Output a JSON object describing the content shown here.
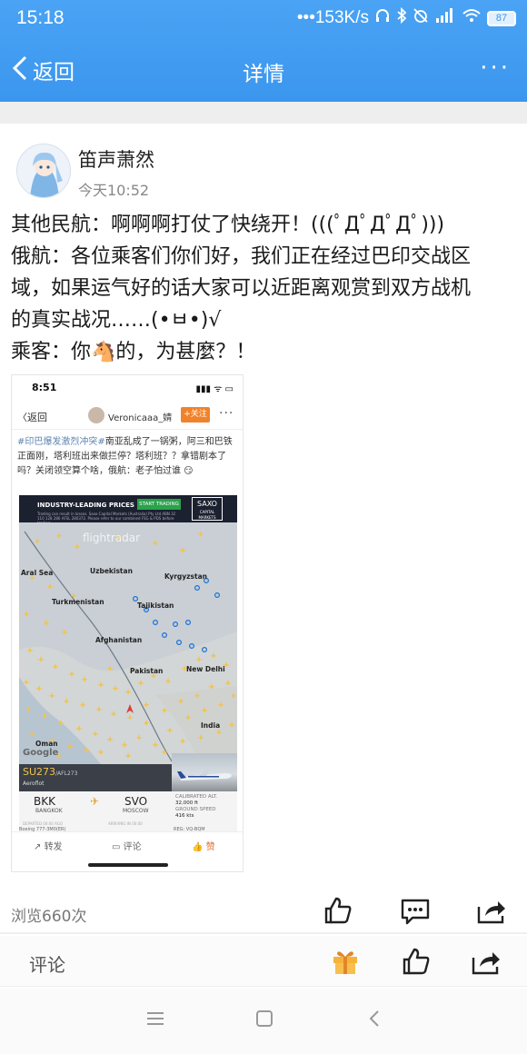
{
  "status_bar": {
    "time": "15:18",
    "network_speed": "•••153K/s",
    "battery": "87",
    "icons": [
      "headphone-icon",
      "bluetooth-icon",
      "alarm-off-icon",
      "signal-icon",
      "wifi-icon",
      "battery-icon"
    ]
  },
  "app_bar": {
    "back_label": "返回",
    "title": "详情",
    "more_label": "···"
  },
  "post": {
    "author": "笛声萧然",
    "time": "今天10:52",
    "lines": [
      "其他民航：啊啊啊打仗了快绕开！(((ﾟДﾟДﾟДﾟ)))",
      "俄航：各位乘客们你们好，我们正在经过巴印交战区",
      "域，如果运气好的话大家可以近距离观赏到双方战机",
      "的真实战况……(•ㅂ•)√",
      "乘客：你🐴的，为甚麼？！"
    ]
  },
  "embedded": {
    "time": "8:51",
    "status_icons": "▮▮▮ ᯤ ▭",
    "back": "〈返回",
    "username": "Veronicaaa_婧",
    "follow": "+关注",
    "more": "···",
    "text_tag": "#印巴爆发激烈冲突#",
    "text_body": "南亚乱成了一锅粥，阿三和巴铁正面刚，塔利班出来做拦停？塔利班？？拿错剧本了吗？关闭领空算个啥，俄航：老子怕过谁",
    "ad_title": "INDUSTRY-LEADING PRICES",
    "ad_button": "START TRADING",
    "ad_logo": "SAXO",
    "ad_logo_sub": "CAPITAL MARKETS",
    "ad_small": "Trading can result in losses. Saxo Capital Markets (Australia) Pty Ltd ABN 32 110 128 286 AFSL 280372. Please refer to our combined FSG & PDS before trading.",
    "map_watermark": "flightradar",
    "map_labels": [
      "Uzbekistan",
      "Kyrgyzstan",
      "Turkmenistan",
      "Tajikistan",
      "Afghanistan",
      "Pakistan",
      "New Delhi",
      "India",
      "Oman",
      "Aral Sea"
    ],
    "google": "Google",
    "flight_number": "SU273",
    "flight_code": "/AFL273",
    "airline": "Aeroflot",
    "from_code": "BKK",
    "from_city": "BANGKOK",
    "to_code": "SVO",
    "to_city": "MOSCOW",
    "departed": "DEPARTED 00:00 AGO",
    "arriving": "ARRIVING IN 00:00",
    "alt_label": "CALIBRATED ALT.",
    "alt_value": "32,000 ft",
    "speed_label": "GROUND SPEED",
    "speed_value": "416 kts",
    "aircraft": "Boeing 777-3M0(ER)",
    "reg": "REG: VQ-BQM",
    "actions": [
      "转发",
      "评论",
      "赞"
    ]
  },
  "footer": {
    "views": "浏览660次",
    "comment_placeholder": "评论"
  },
  "colors": {
    "app_bar": "#3b96ee",
    "link": "#5c84b0",
    "follow": "#f0822c",
    "flight_yellow": "#f2c34c"
  }
}
